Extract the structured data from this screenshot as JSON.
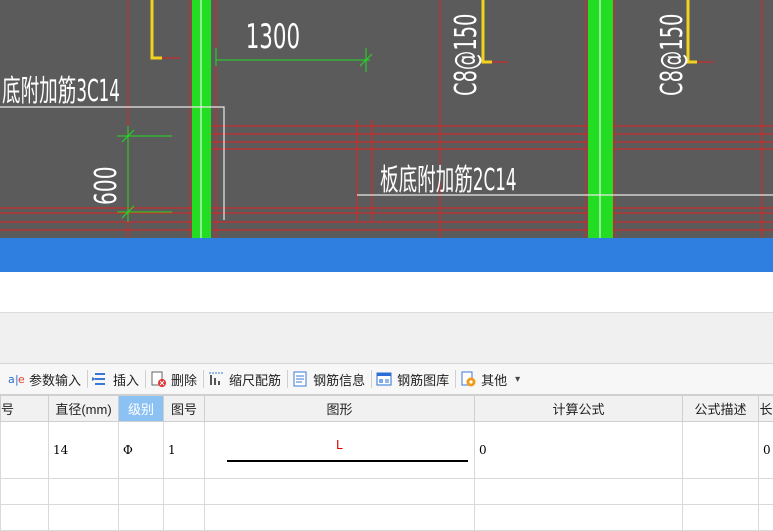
{
  "cad": {
    "dim_1300": "1300",
    "dim_600": "600",
    "label_3c14": "底附加筋3C14",
    "label_2c14": "板底附加筋2C14",
    "label_c8_1": "C8@150",
    "label_c8_2": "C8@150",
    "colors": {
      "background": "#5b5b5b",
      "red": "#e02020",
      "green": "#22dd22",
      "yellow": "#f2d21c",
      "white": "#ffffff"
    }
  },
  "toolbar": {
    "items": [
      {
        "label": "参数输入",
        "icon": "param-input-icon"
      },
      {
        "label": "插入",
        "icon": "insert-icon"
      },
      {
        "label": "删除",
        "icon": "delete-icon"
      },
      {
        "label": "缩尺配筋",
        "icon": "scale-rebar-icon"
      },
      {
        "label": "钢筋信息",
        "icon": "rebar-info-icon"
      },
      {
        "label": "钢筋图库",
        "icon": "rebar-library-icon"
      },
      {
        "label": "其他",
        "icon": "other-icon"
      }
    ],
    "dropdown_glyph": "▾"
  },
  "grid": {
    "headers": [
      "号",
      "直径(mm)",
      "级别",
      "图号",
      "图形",
      "计算公式",
      "公式描述",
      "长"
    ],
    "rows": [
      {
        "id": "",
        "diameter": "14",
        "grade": "Φ",
        "fig_no": "1",
        "shape": "L",
        "formula": "0",
        "desc": "",
        "len": "0"
      }
    ]
  }
}
